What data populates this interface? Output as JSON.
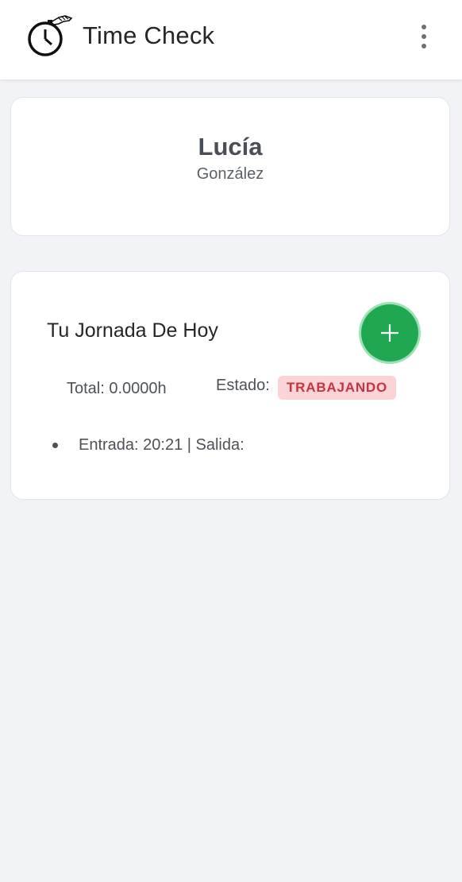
{
  "appbar": {
    "title": "Time Check",
    "logo_icon": "stopwatch-hand-icon",
    "menu_icon": "more-vert-icon"
  },
  "profile": {
    "first_name": "Lucía",
    "last_name": "González"
  },
  "today": {
    "title": "Tu Jornada De Hoy",
    "add_icon": "plus-icon",
    "total_text": "Total: 0.0000h",
    "status_label": "Estado:",
    "status_value": "TRABAJANDO",
    "entries": [
      {
        "text": "Entrada: 20:21 | Salida:"
      }
    ]
  },
  "colors": {
    "background": "#f2f3f7",
    "accent_green": "#1fa851",
    "status_badge_bg": "#fad4d6",
    "status_badge_text": "#c5343f"
  }
}
